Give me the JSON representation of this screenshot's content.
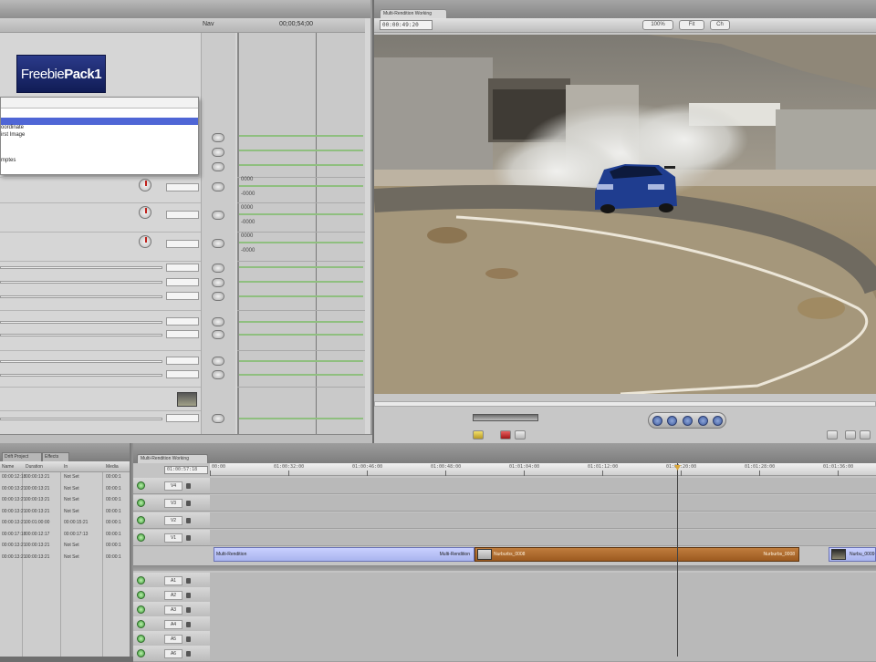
{
  "filters": {
    "logo_text_plain": "Freebie",
    "logo_text_bold": "Pack1",
    "header_nav": "Nav",
    "header_tc1": "00;00;54;00",
    "dropdown_options": [
      "",
      "",
      "oordinate",
      "irst Image",
      "",
      "",
      "mptes"
    ],
    "kf_values": [
      "0000",
      "-0000",
      "0000",
      "-0000",
      "0000",
      "-0000"
    ]
  },
  "viewer": {
    "tab_label": "Multi-Rendition Working",
    "timecode": "00:00:49:20",
    "zoom": "100%",
    "view_mode": "Fit",
    "view_mode_2": "Ch"
  },
  "browser": {
    "tabs": [
      "Drift Project",
      "Effects"
    ],
    "columns": [
      "Name",
      "Duration",
      "In",
      "Out",
      "Media"
    ],
    "rows": [
      [
        "00:00:12:18",
        "00:00:13:21",
        "Not Set",
        "Not Set",
        "00:00:1"
      ],
      [
        "00:00:13:21",
        "00:00:13:21",
        "Not Set",
        "Not Set",
        "00:00:1"
      ],
      [
        "00:00:13:21",
        "00:00:13:21",
        "Not Set",
        "Not Set",
        "00:00:1"
      ],
      [
        "00:00:13:21",
        "00:00:13:21",
        "Not Set",
        "Not Set",
        "00:00:1"
      ],
      [
        "00:00:13:21",
        "00:01:00:00",
        "00:00:15:21",
        "Not Set",
        "00:00:1"
      ],
      [
        "00:00:17:18",
        "00:00:12:17",
        "00:00:17:13",
        "Not Set",
        "00:00:1"
      ],
      [
        "00:00:13:21",
        "00:00:13:21",
        "Not Set",
        "Not Set",
        "00:00:1"
      ],
      [
        "00:00:13:21",
        "00:00:13:21",
        "Not Set",
        "Not Set",
        "00:00:1"
      ]
    ]
  },
  "timeline": {
    "tab_label": "Multi-Rendition Working",
    "current_tc": "01:00:57:18",
    "ruler_labels": [
      "00:00",
      "01:00:32:00",
      "01:00:46:00",
      "01:00:48:00",
      "01:01:04:00",
      "01:01:12:00",
      "01:01:20:00",
      "01:01:28:00",
      "01:01:36:00"
    ],
    "video_tracks": [
      "V4",
      "V3",
      "V2",
      "V1"
    ],
    "audio_tracks": [
      "A1",
      "A2",
      "A3",
      "A4",
      "A5",
      "A6"
    ],
    "clip1_name": "Multi-Rendition",
    "clip1_name_end": "Multi-Rendition",
    "clip2_name": "Nurburbs_0008",
    "clip2_name_end": "Nurburbs_0008",
    "clip3_name": "Nurbu_0009"
  },
  "colors": {
    "selection": "#4f66d6",
    "clip_blue": "#a9b4ee",
    "clip_orange": "#9c5a20",
    "enabled_green": "#3a9a35"
  }
}
